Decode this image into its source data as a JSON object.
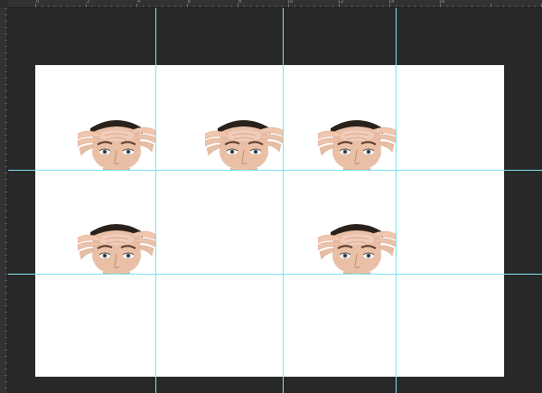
{
  "ruler": {
    "labels": [
      "0",
      "2",
      "4",
      "6",
      "8",
      "10",
      "12",
      "14",
      "16"
    ]
  },
  "document": {
    "background": "#ffffff",
    "workspace_color": "#282828",
    "guide_color": "#7fe3ee"
  },
  "photos": [
    {
      "subject": "face-pulling-forehead-skin"
    },
    {
      "subject": "face-pulling-forehead-skin"
    },
    {
      "subject": "face-pulling-forehead-skin"
    },
    {
      "subject": "face-pulling-forehead-skin"
    },
    {
      "subject": "face-pulling-forehead-skin"
    }
  ]
}
